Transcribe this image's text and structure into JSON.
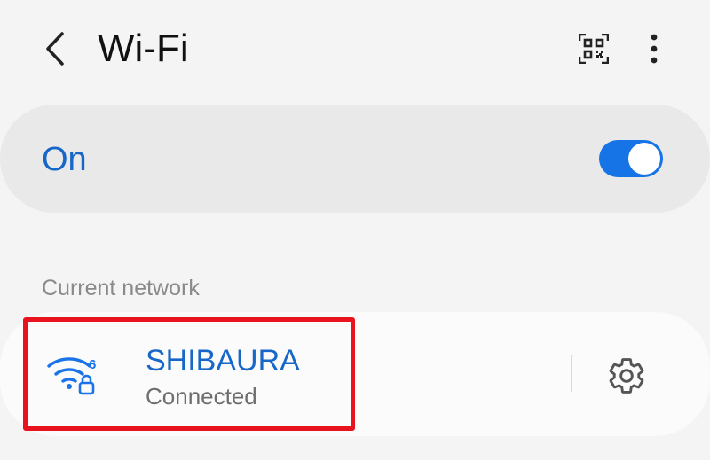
{
  "appbar": {
    "title": "Wi-Fi",
    "back_icon": "back-arrow-icon",
    "qr_icon": "qr-scan-icon",
    "more_icon": "more-vert-icon"
  },
  "wifi_toggle": {
    "label": "On",
    "state": true
  },
  "current_network": {
    "section_label": "Current network",
    "ssid": "SHIBAURA",
    "status": "Connected",
    "signal_icon": "wifi6-secured-icon",
    "settings_icon": "gear-icon"
  },
  "colors": {
    "accent": "#1667c7",
    "toggle_track": "#1774e6",
    "background": "#f4f4f4",
    "highlight": "#e8131e"
  }
}
